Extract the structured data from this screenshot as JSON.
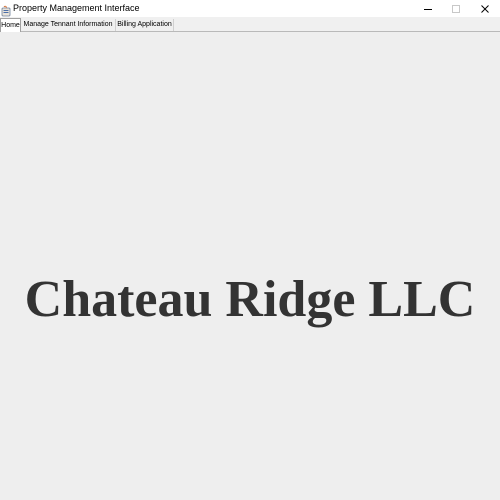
{
  "window": {
    "title": "Property Management Interface",
    "app_icon": "java-app-icon",
    "controls": {
      "minimize_icon": "minimize-icon",
      "maximize_icon": "maximize-icon",
      "close_icon": "close-icon"
    }
  },
  "tabs": [
    {
      "label": "Home",
      "selected": true
    },
    {
      "label": "Manage Tennant Information",
      "selected": false
    },
    {
      "label": "Billing Application",
      "selected": false
    }
  ],
  "main": {
    "company_name": "Chateau Ridge LLC"
  },
  "colors": {
    "content_background": "#eeeeee",
    "heading_text": "#333333"
  }
}
